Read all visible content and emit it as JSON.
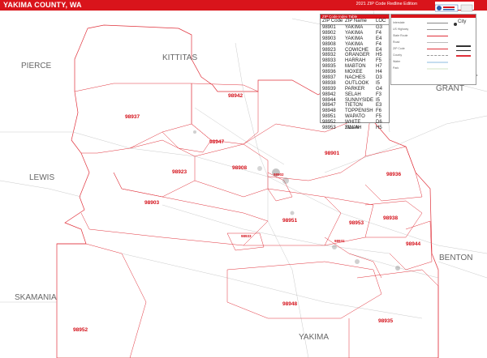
{
  "header": {
    "title": "YAKIMA COUNTY, WA",
    "edition": "2021 ZIP Code Redline Edition"
  },
  "colors": {
    "brand_red": "#d9141b",
    "zip_label": "#d4111a",
    "boundary_red": "#e0303a",
    "county_line": "#999999",
    "road": "#bdbdbd"
  },
  "map": {
    "counties": [
      "PIERCE",
      "KITTITAS",
      "GRANT",
      "LEWIS",
      "BENTON",
      "SKAMANIA",
      "YAKIMA"
    ],
    "zip_labels": [
      "98942",
      "98937",
      "98947",
      "98923",
      "98908",
      "98901",
      "98936",
      "98903",
      "98951",
      "98953",
      "98938",
      "98933",
      "98944",
      "98948",
      "98935",
      "98952",
      "98902",
      "98932"
    ],
    "compass_icon": "compass-rose-icon"
  },
  "zip_table": {
    "title": "ZIP Code Index Table",
    "columns": [
      "ZIP Code",
      "ZIP Name",
      "LOC"
    ],
    "rows": [
      [
        "98901",
        "YAKIMA",
        "G3"
      ],
      [
        "98902",
        "YAKIMA",
        "F4"
      ],
      [
        "98903",
        "YAKIMA",
        "E4"
      ],
      [
        "98908",
        "YAKIMA",
        "F4"
      ],
      [
        "98923",
        "COWICHE",
        "E4"
      ],
      [
        "98932",
        "GRANGER",
        "H5"
      ],
      [
        "98933",
        "HARRAH",
        "F5"
      ],
      [
        "98935",
        "MABTON",
        "H7"
      ],
      [
        "98936",
        "MOXEE",
        "H4"
      ],
      [
        "98937",
        "NACHES",
        "D3"
      ],
      [
        "98938",
        "OUTLOOK",
        "I5"
      ],
      [
        "98939",
        "PARKER",
        "G4"
      ],
      [
        "98942",
        "SELAH",
        "F3"
      ],
      [
        "98944",
        "SUNNYSIDE",
        "I5"
      ],
      [
        "98947",
        "TIETON",
        "E3"
      ],
      [
        "98948",
        "TOPPENISH",
        "F6"
      ],
      [
        "98951",
        "WAPATO",
        "F5"
      ],
      [
        "98952",
        "WHITE SWAN",
        "D6"
      ],
      [
        "98953",
        "ZILLAH",
        "H5"
      ]
    ]
  },
  "legend": {
    "city_label": "City"
  }
}
